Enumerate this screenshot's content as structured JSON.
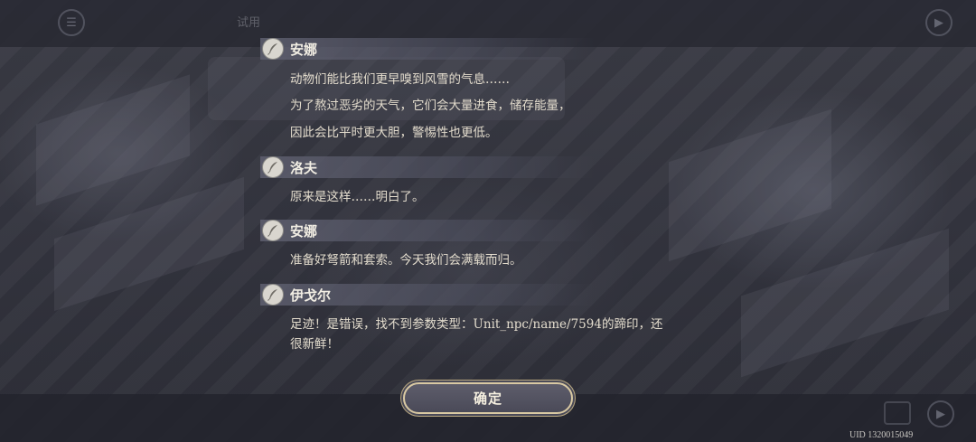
{
  "hud": {
    "location_text": "试用"
  },
  "dialog_log": [
    {
      "speaker": "安娜",
      "lines": [
        "动物们能比我们更早嗅到风雪的气息……",
        "为了熬过恶劣的天气，它们会大量进食，储存能量，",
        "因此会比平时更大胆，警惕性也更低。"
      ]
    },
    {
      "speaker": "洛夫",
      "lines": [
        "原来是这样……明白了。"
      ]
    },
    {
      "speaker": "安娜",
      "lines": [
        "准备好弩箭和套索。今天我们会满载而归。"
      ]
    },
    {
      "speaker": "伊戈尔",
      "lines": [
        "足迹！是错误，找不到参数类型：Unit_npc/name/7594的蹄印，还",
        "很新鲜！"
      ]
    }
  ],
  "confirm_button": {
    "label": "确定"
  },
  "uid_text": "UID 1320015049",
  "icons": {
    "speaker_icon": "quill-icon",
    "menu": "menu-icon",
    "play": "play-icon",
    "fast_forward": "fast-forward-icon",
    "log": "log-icon"
  }
}
